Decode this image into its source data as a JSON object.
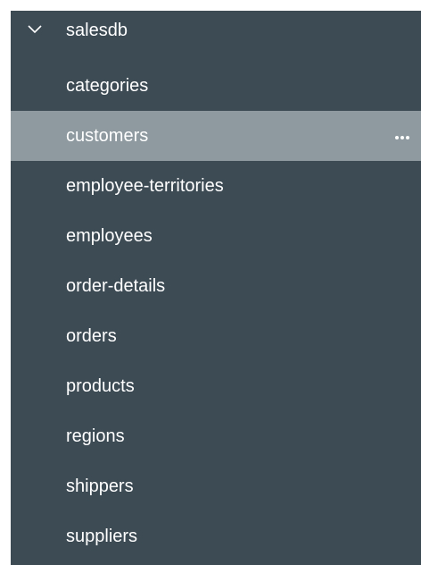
{
  "colors": {
    "panel_bg": "#3d4b55",
    "selected_bg": "#8e9aa0",
    "text": "#ffffff"
  },
  "database": {
    "name": "salesdb",
    "expanded": true,
    "icon": "chevron-down-icon"
  },
  "collections": [
    {
      "label": "categories",
      "selected": false
    },
    {
      "label": "customers",
      "selected": true,
      "actions_icon": "more-options-icon"
    },
    {
      "label": "employee-territories",
      "selected": false
    },
    {
      "label": "employees",
      "selected": false
    },
    {
      "label": "order-details",
      "selected": false
    },
    {
      "label": "orders",
      "selected": false
    },
    {
      "label": "products",
      "selected": false
    },
    {
      "label": "regions",
      "selected": false
    },
    {
      "label": "shippers",
      "selected": false
    },
    {
      "label": "suppliers",
      "selected": false
    }
  ]
}
